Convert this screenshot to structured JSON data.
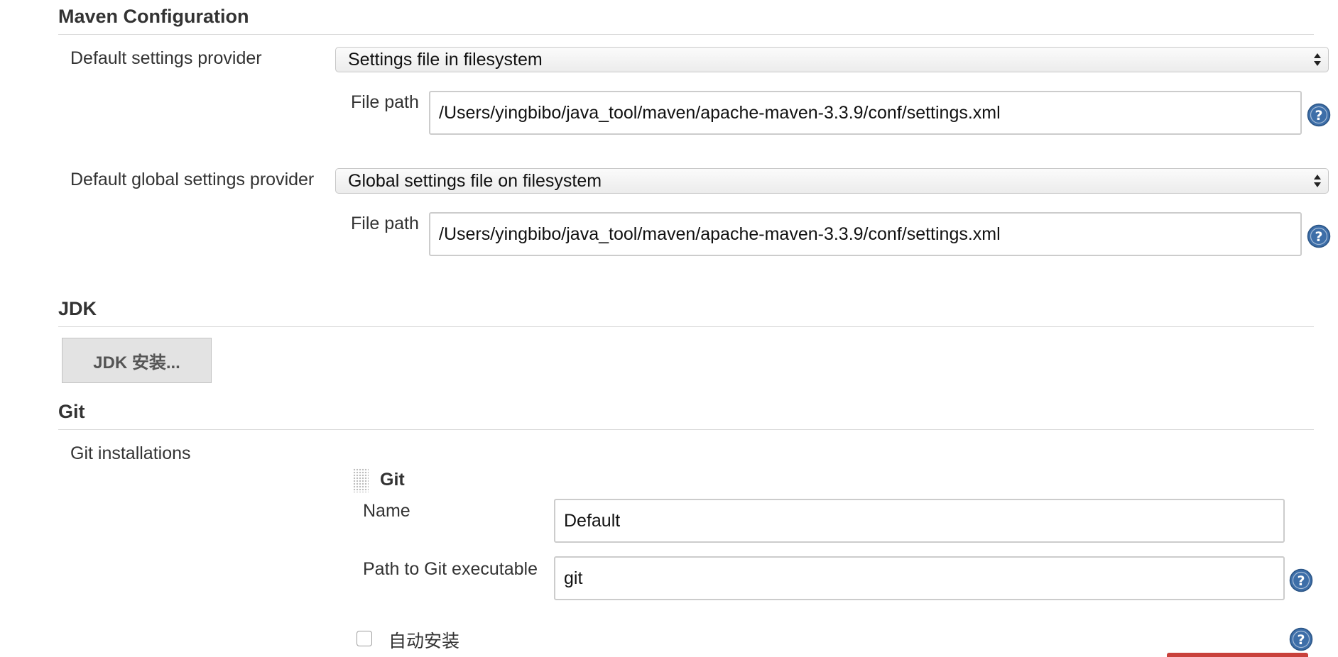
{
  "maven": {
    "title": "Maven Configuration",
    "settings_provider": {
      "label": "Default settings provider",
      "selected": "Settings file in filesystem",
      "file_path_label": "File path",
      "file_path_value": "/Users/yingbibo/java_tool/maven/apache-maven-3.3.9/conf/settings.xml"
    },
    "global_settings_provider": {
      "label": "Default global settings provider",
      "selected": "Global settings file on filesystem",
      "file_path_label": "File path",
      "file_path_value": "/Users/yingbibo/java_tool/maven/apache-maven-3.3.9/conf/settings.xml"
    }
  },
  "jdk": {
    "title": "JDK",
    "install_button": "JDK 安装..."
  },
  "git": {
    "title": "Git",
    "installations_label": "Git installations",
    "entry": {
      "title": "Git",
      "name_label": "Name",
      "name_value": "Default",
      "path_label": "Path to Git executable",
      "path_value": "git",
      "auto_install_label": "自动安装",
      "auto_install_checked": false
    }
  },
  "icons": {
    "help": "help-icon",
    "select_arrows": "select-arrows-icon",
    "drag": "drag-handle-icon"
  },
  "colors": {
    "help_blue": "#3d6ea8",
    "delete_red": "#c9413b",
    "section_rule": "#d8d8d8"
  }
}
